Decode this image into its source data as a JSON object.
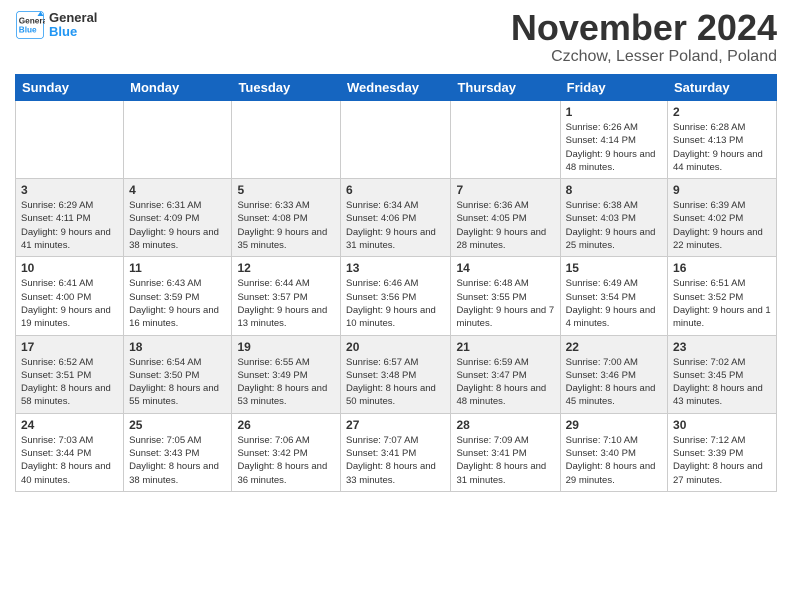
{
  "logo": {
    "general": "General",
    "blue": "Blue"
  },
  "header": {
    "title": "November 2024",
    "location": "Czchow, Lesser Poland, Poland"
  },
  "days_of_week": [
    "Sunday",
    "Monday",
    "Tuesday",
    "Wednesday",
    "Thursday",
    "Friday",
    "Saturday"
  ],
  "weeks": [
    [
      {
        "day": "",
        "info": ""
      },
      {
        "day": "",
        "info": ""
      },
      {
        "day": "",
        "info": ""
      },
      {
        "day": "",
        "info": ""
      },
      {
        "day": "",
        "info": ""
      },
      {
        "day": "1",
        "info": "Sunrise: 6:26 AM\nSunset: 4:14 PM\nDaylight: 9 hours and 48 minutes."
      },
      {
        "day": "2",
        "info": "Sunrise: 6:28 AM\nSunset: 4:13 PM\nDaylight: 9 hours and 44 minutes."
      }
    ],
    [
      {
        "day": "3",
        "info": "Sunrise: 6:29 AM\nSunset: 4:11 PM\nDaylight: 9 hours and 41 minutes."
      },
      {
        "day": "4",
        "info": "Sunrise: 6:31 AM\nSunset: 4:09 PM\nDaylight: 9 hours and 38 minutes."
      },
      {
        "day": "5",
        "info": "Sunrise: 6:33 AM\nSunset: 4:08 PM\nDaylight: 9 hours and 35 minutes."
      },
      {
        "day": "6",
        "info": "Sunrise: 6:34 AM\nSunset: 4:06 PM\nDaylight: 9 hours and 31 minutes."
      },
      {
        "day": "7",
        "info": "Sunrise: 6:36 AM\nSunset: 4:05 PM\nDaylight: 9 hours and 28 minutes."
      },
      {
        "day": "8",
        "info": "Sunrise: 6:38 AM\nSunset: 4:03 PM\nDaylight: 9 hours and 25 minutes."
      },
      {
        "day": "9",
        "info": "Sunrise: 6:39 AM\nSunset: 4:02 PM\nDaylight: 9 hours and 22 minutes."
      }
    ],
    [
      {
        "day": "10",
        "info": "Sunrise: 6:41 AM\nSunset: 4:00 PM\nDaylight: 9 hours and 19 minutes."
      },
      {
        "day": "11",
        "info": "Sunrise: 6:43 AM\nSunset: 3:59 PM\nDaylight: 9 hours and 16 minutes."
      },
      {
        "day": "12",
        "info": "Sunrise: 6:44 AM\nSunset: 3:57 PM\nDaylight: 9 hours and 13 minutes."
      },
      {
        "day": "13",
        "info": "Sunrise: 6:46 AM\nSunset: 3:56 PM\nDaylight: 9 hours and 10 minutes."
      },
      {
        "day": "14",
        "info": "Sunrise: 6:48 AM\nSunset: 3:55 PM\nDaylight: 9 hours and 7 minutes."
      },
      {
        "day": "15",
        "info": "Sunrise: 6:49 AM\nSunset: 3:54 PM\nDaylight: 9 hours and 4 minutes."
      },
      {
        "day": "16",
        "info": "Sunrise: 6:51 AM\nSunset: 3:52 PM\nDaylight: 9 hours and 1 minute."
      }
    ],
    [
      {
        "day": "17",
        "info": "Sunrise: 6:52 AM\nSunset: 3:51 PM\nDaylight: 8 hours and 58 minutes."
      },
      {
        "day": "18",
        "info": "Sunrise: 6:54 AM\nSunset: 3:50 PM\nDaylight: 8 hours and 55 minutes."
      },
      {
        "day": "19",
        "info": "Sunrise: 6:55 AM\nSunset: 3:49 PM\nDaylight: 8 hours and 53 minutes."
      },
      {
        "day": "20",
        "info": "Sunrise: 6:57 AM\nSunset: 3:48 PM\nDaylight: 8 hours and 50 minutes."
      },
      {
        "day": "21",
        "info": "Sunrise: 6:59 AM\nSunset: 3:47 PM\nDaylight: 8 hours and 48 minutes."
      },
      {
        "day": "22",
        "info": "Sunrise: 7:00 AM\nSunset: 3:46 PM\nDaylight: 8 hours and 45 minutes."
      },
      {
        "day": "23",
        "info": "Sunrise: 7:02 AM\nSunset: 3:45 PM\nDaylight: 8 hours and 43 minutes."
      }
    ],
    [
      {
        "day": "24",
        "info": "Sunrise: 7:03 AM\nSunset: 3:44 PM\nDaylight: 8 hours and 40 minutes."
      },
      {
        "day": "25",
        "info": "Sunrise: 7:05 AM\nSunset: 3:43 PM\nDaylight: 8 hours and 38 minutes."
      },
      {
        "day": "26",
        "info": "Sunrise: 7:06 AM\nSunset: 3:42 PM\nDaylight: 8 hours and 36 minutes."
      },
      {
        "day": "27",
        "info": "Sunrise: 7:07 AM\nSunset: 3:41 PM\nDaylight: 8 hours and 33 minutes."
      },
      {
        "day": "28",
        "info": "Sunrise: 7:09 AM\nSunset: 3:41 PM\nDaylight: 8 hours and 31 minutes."
      },
      {
        "day": "29",
        "info": "Sunrise: 7:10 AM\nSunset: 3:40 PM\nDaylight: 8 hours and 29 minutes."
      },
      {
        "day": "30",
        "info": "Sunrise: 7:12 AM\nSunset: 3:39 PM\nDaylight: 8 hours and 27 minutes."
      }
    ]
  ]
}
